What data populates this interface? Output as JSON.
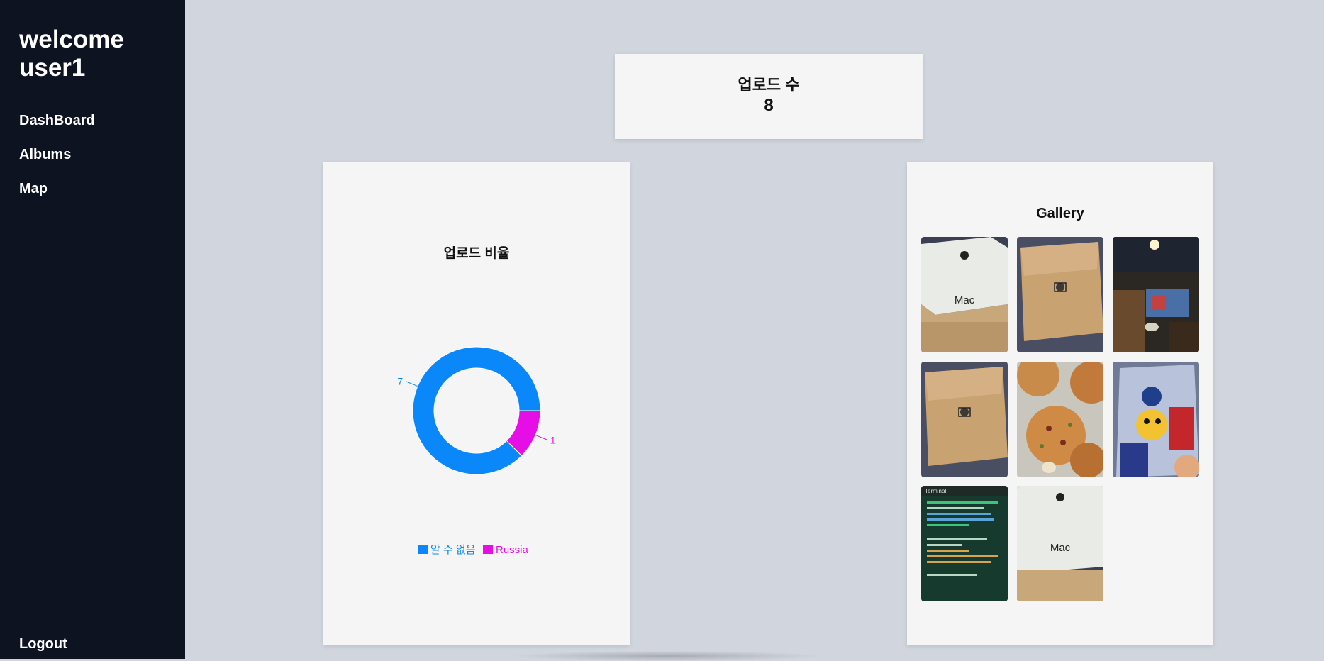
{
  "sidebar": {
    "welcome": "welcome user1",
    "nav": [
      {
        "label": "DashBoard"
      },
      {
        "label": "Albums"
      },
      {
        "label": "Map"
      }
    ],
    "logout": "Logout"
  },
  "upload_count": {
    "label": "업로드 수",
    "value": "8"
  },
  "upload_ratio": {
    "title": "업로드 비율"
  },
  "gallery": {
    "title": "Gallery",
    "photos": [
      {
        "name": "mac-box-photo",
        "image_text": "Mac"
      },
      {
        "name": "cardboard-box-photo"
      },
      {
        "name": "restaurant-projector-photo"
      },
      {
        "name": "cardboard-box-photo"
      },
      {
        "name": "pizza-photo"
      },
      {
        "name": "toy-package-photo"
      },
      {
        "name": "terminal-screen-photo",
        "image_text": "Terminal"
      },
      {
        "name": "mac-box-photo",
        "image_text": "Mac"
      }
    ]
  },
  "chart_data": {
    "type": "pie",
    "title": "업로드 비율",
    "categories": [
      "알 수 없음",
      "Russia"
    ],
    "values": [
      7,
      1
    ],
    "colors": [
      "#0a88fa",
      "#e60ee6"
    ],
    "donut": true,
    "legend": "bottom"
  }
}
